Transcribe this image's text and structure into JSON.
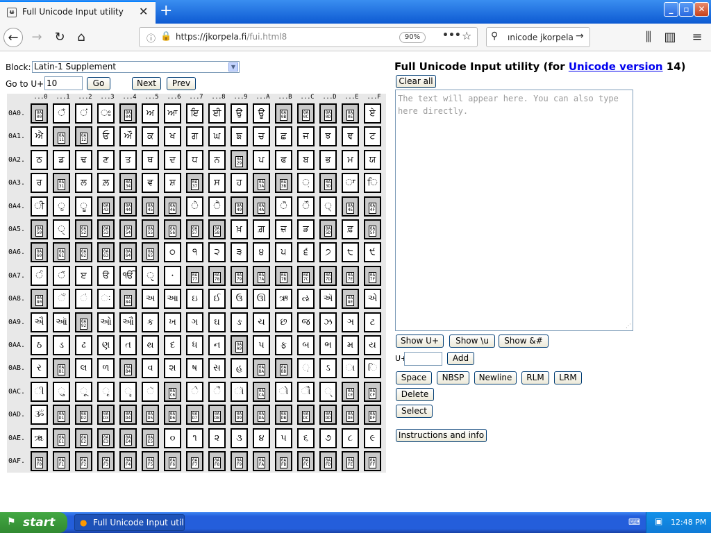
{
  "browser": {
    "tab_title": "Full Unicode Input utility",
    "tab_close": "✕",
    "new_tab": "+",
    "url_prefix": "https://jkorpela.fi",
    "url_path": "/fui.html8",
    "zoom": "90%",
    "search_text": "ınicode jkorpela",
    "window_controls": [
      "_",
      "▫",
      "✕"
    ]
  },
  "page": {
    "block_label": "Block:",
    "block_value": "Latin-1 Supplement",
    "goto_label": "Go to U+",
    "goto_value": "10",
    "go_button": "Go",
    "next_button": "Next",
    "prev_button": "Prev",
    "title_prefix": "Full Unicode Input utility (for ",
    "title_link": "Unicode version",
    "title_suffix": " 14)",
    "clear_all": "Clear all",
    "textarea_placeholder": "The text will appear here. You can also type here directly.",
    "show_uplus": "Show U+",
    "show_u": "Show \\u",
    "show_amp": "Show &#",
    "uplus_label": "U+",
    "add_button": "Add",
    "space_button": "Space",
    "nbsp_button": "NBSP",
    "newline_button": "Newline",
    "rlm_button": "RLM",
    "lrm_button": "LRM",
    "delete_button": "Delete",
    "select_button": "Select",
    "instructions_button": "Instructions and info"
  },
  "grid": {
    "column_headers": [
      "...0",
      "...1",
      "...2",
      "...3",
      "...4",
      "...5",
      "...6",
      "...7",
      "...8",
      "...9",
      "...A",
      "...B",
      "...C",
      "...D",
      "...E",
      "...F"
    ],
    "rows": [
      {
        "label": "0A0.",
        "cells": [
          "#0A00",
          "ਁ",
          "ਂ",
          "ਃ",
          "#0A04",
          "ਅ",
          "ਆ",
          "ਇ",
          "ਈ",
          "ਉ",
          "ਊ",
          "#0A0B",
          "#0A0C",
          "#0A0D",
          "#0A0E",
          "ਏ"
        ]
      },
      {
        "label": "0A1.",
        "cells": [
          "ਐ",
          "#0A11",
          "#0A12",
          "ਓ",
          "ਔ",
          "ਕ",
          "ਖ",
          "ਗ",
          "ਘ",
          "ਙ",
          "ਚ",
          "ਛ",
          "ਜ",
          "ਝ",
          "ਞ",
          "ਟ"
        ]
      },
      {
        "label": "0A2.",
        "cells": [
          "ਠ",
          "ਡ",
          "ਢ",
          "ਣ",
          "ਤ",
          "ਥ",
          "ਦ",
          "ਧ",
          "ਨ",
          "#0A29",
          "ਪ",
          "ਫ",
          "ਬ",
          "ਭ",
          "ਮ",
          "ਯ"
        ]
      },
      {
        "label": "0A3.",
        "cells": [
          "ਰ",
          "#0A31",
          "ਲ",
          "ਲ਼",
          "#0A34",
          "ਵ",
          "ਸ਼",
          "#0A37",
          "ਸ",
          "ਹ",
          "#0A3A",
          "#0A3B",
          "਼",
          "#0A3D",
          "ਾ",
          "ਿ"
        ]
      },
      {
        "label": "0A4.",
        "cells": [
          "ੀ",
          "ੁ",
          "ੂ",
          "#0A43",
          "#0A44",
          "#0A45",
          "#0A46",
          "ੇ",
          "ੈ",
          "#0A49",
          "#0A4A",
          "ੋ",
          "ੌ",
          "੍",
          "#0A4E",
          "#0A4F"
        ]
      },
      {
        "label": "0A5.",
        "cells": [
          "#0A50",
          "ੑ",
          "#0A52",
          "#0A53",
          "#0A54",
          "#0A55",
          "#0A56",
          "#0A57",
          "#0A58",
          "ਖ਼",
          "ਗ਼",
          "ਜ਼",
          "ੜ",
          "#0A5D",
          "ਫ਼",
          "#0A5F"
        ]
      },
      {
        "label": "0A6.",
        "cells": [
          "#0A60",
          "#0A61",
          "#0A62",
          "#0A63",
          "#0A64",
          "#0A65",
          "੦",
          "੧",
          "੨",
          "੩",
          "੪",
          "੫",
          "੬",
          "੭",
          "੮",
          "੯"
        ]
      },
      {
        "label": "0A7.",
        "cells": [
          "ੰ",
          "ੱ",
          "ੲ",
          "ੳ",
          "ੴ",
          "ੵ",
          "੶",
          "#0A77",
          "#0A78",
          "#0A79",
          "#0A7A",
          "#0A7B",
          "#0A7C",
          "#0A7D",
          "#0A7E",
          "#0A7F"
        ]
      },
      {
        "label": "0A8.",
        "cells": [
          "#0A80",
          "ઁ",
          "ં",
          "ઃ",
          "#0A84",
          "અ",
          "આ",
          "ઇ",
          "ઈ",
          "ઉ",
          "ઊ",
          "ઋ",
          "ઌ",
          "ઍ",
          "#0A8E",
          "એ"
        ]
      },
      {
        "label": "0A9.",
        "cells": [
          "ઐ",
          "ઑ",
          "#0A92",
          "ઓ",
          "ઔ",
          "ક",
          "ખ",
          "ગ",
          "ઘ",
          "ઙ",
          "ચ",
          "છ",
          "જ",
          "ઝ",
          "ઞ",
          "ટ"
        ]
      },
      {
        "label": "0AA.",
        "cells": [
          "ઠ",
          "ડ",
          "ઢ",
          "ણ",
          "ત",
          "થ",
          "દ",
          "ધ",
          "ન",
          "#0AA9",
          "પ",
          "ફ",
          "બ",
          "ભ",
          "મ",
          "ય"
        ]
      },
      {
        "label": "0AB.",
        "cells": [
          "ર",
          "#0AB1",
          "લ",
          "ળ",
          "#0AB4",
          "વ",
          "શ",
          "ષ",
          "સ",
          "હ",
          "#0ABA",
          "#0ABB",
          "઼",
          "ઽ",
          "ા",
          "િ"
        ]
      },
      {
        "label": "0AC.",
        "cells": [
          "ી",
          "ુ",
          "ૂ",
          "ૃ",
          "ૄ",
          "ૅ",
          "#0AC6",
          "ે",
          "ૈ",
          "ૉ",
          "#0ACA",
          "ો",
          "ૌ",
          "્",
          "#0ACE",
          "#0ACF"
        ]
      },
      {
        "label": "0AD.",
        "cells": [
          "ૐ",
          "#0AD1",
          "#0AD2",
          "#0AD3",
          "#0AD4",
          "#0AD5",
          "#0AD6",
          "#0AD7",
          "#0AD8",
          "#0AD9",
          "#0ADA",
          "#0ADB",
          "#0ADC",
          "#0ADD",
          "#0ADE",
          "#0ADF"
        ]
      },
      {
        "label": "0AE.",
        "cells": [
          "ૠ",
          "#0AE1",
          "#0AE2",
          "#0AE3",
          "#0AE4",
          "#0AE5",
          "૦",
          "૧",
          "૨",
          "૩",
          "૪",
          "૫",
          "૬",
          "૭",
          "૮",
          "૯"
        ]
      },
      {
        "label": "0AF.",
        "cells": [
          "#0AF0",
          "#0AF1",
          "#0AF2",
          "#0AF3",
          "#0AF4",
          "#0AF5",
          "#0AF6",
          "#0AF7",
          "#0AF8",
          "#0AF9",
          "#0AFA",
          "#0AFB",
          "#0AFC",
          "#0AFD",
          "#0AFE",
          "#0AFF"
        ]
      }
    ]
  },
  "taskbar": {
    "start": "start",
    "task_item": "Full Unicode Input util...",
    "clock": "12:48 PM"
  }
}
